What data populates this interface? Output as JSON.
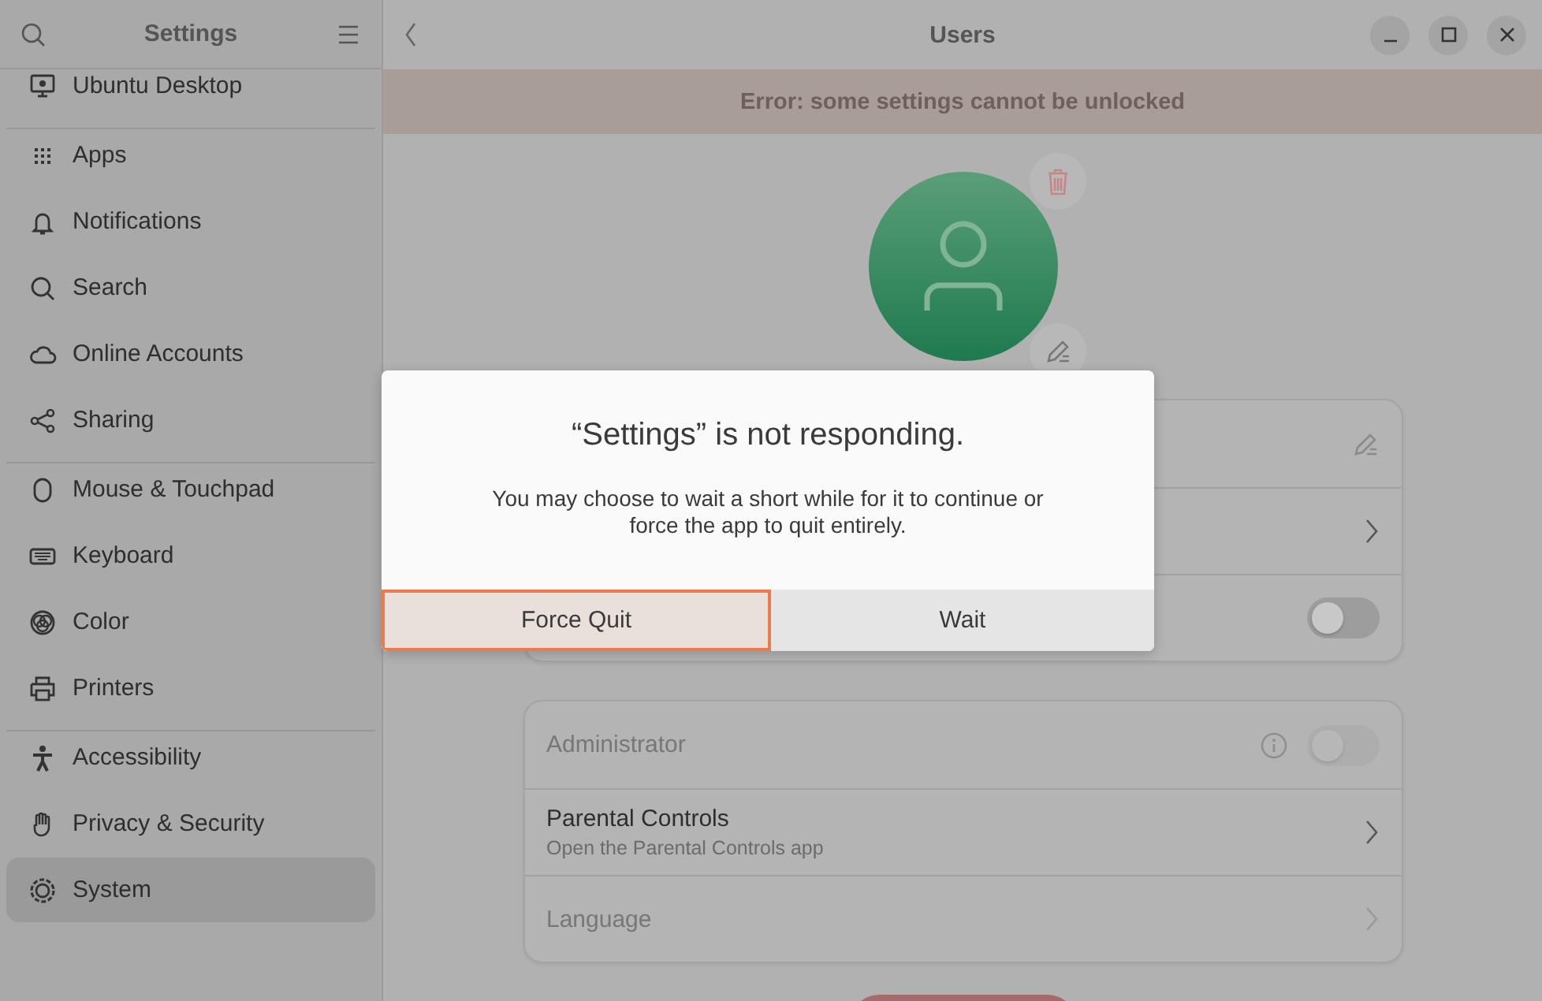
{
  "sidebar": {
    "title": "Settings",
    "groups": [
      {
        "items": [
          {
            "label": "Ubuntu Desktop",
            "selected": false
          }
        ]
      },
      {
        "items": [
          {
            "label": "Apps",
            "selected": false
          },
          {
            "label": "Notifications",
            "selected": false
          },
          {
            "label": "Search",
            "selected": false
          },
          {
            "label": "Online Accounts",
            "selected": false
          },
          {
            "label": "Sharing",
            "selected": false
          }
        ]
      },
      {
        "items": [
          {
            "label": "Mouse & Touchpad",
            "selected": false
          },
          {
            "label": "Keyboard",
            "selected": false
          },
          {
            "label": "Color",
            "selected": false
          },
          {
            "label": "Printers",
            "selected": false
          }
        ]
      },
      {
        "items": [
          {
            "label": "Accessibility",
            "selected": false
          },
          {
            "label": "Privacy & Security",
            "selected": false
          },
          {
            "label": "System",
            "selected": true
          }
        ]
      }
    ]
  },
  "header": {
    "title": "Users"
  },
  "banner": {
    "text": "Error: some settings cannot be unlocked"
  },
  "cards": [
    {
      "rows": [
        {
          "kind": "edit"
        },
        {
          "kind": "link"
        },
        {
          "kind": "switch",
          "on": false
        }
      ]
    },
    {
      "rows": [
        {
          "kind": "switch",
          "title": "Administrator",
          "on": false,
          "disabled": true,
          "info": true
        },
        {
          "kind": "link",
          "title": "Parental Controls",
          "subtitle": "Open the Parental Controls app",
          "disabled": false
        },
        {
          "kind": "link",
          "title": "Language",
          "disabled": true
        }
      ]
    }
  ],
  "dialog": {
    "title": "“Settings” is not responding.",
    "body": "You may choose to wait a short while for it to continue or force the app to quit entirely.",
    "buttons": [
      {
        "label": "Force Quit",
        "focused": true
      },
      {
        "label": "Wait",
        "focused": false
      }
    ]
  }
}
